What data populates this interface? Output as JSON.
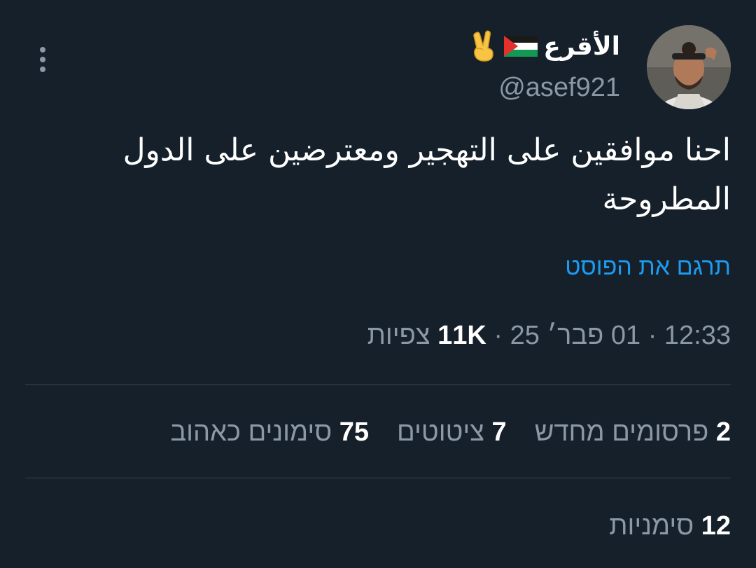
{
  "post": {
    "author_name": "الأقرع",
    "author_handle": "@asef921",
    "text": "احنا موافقين على التهجير ومعترضين على الدول المطروحة",
    "translate_label": "תרגם את הפוסט",
    "time": "12:33",
    "date": "01 פבר׳ 25",
    "separator": "·",
    "views_count": "11K",
    "views_label": "צפיות"
  },
  "stats": {
    "reposts_count": "2",
    "reposts_label": "פרסומים מחדש",
    "quotes_count": "7",
    "quotes_label": "ציטוטים",
    "likes_count": "75",
    "likes_label": "סימונים כאהוב",
    "bookmarks_count": "12",
    "bookmarks_label": "סימניות"
  },
  "icons": {
    "more": "more-vertical-icon",
    "flag": "palestine-flag-icon",
    "victory": "victory-hand-icon"
  },
  "colors": {
    "background": "#15202b",
    "text_primary": "#ffffff",
    "text_secondary": "#8b98a5",
    "link": "#1d9bf0",
    "divider": "#38444d"
  }
}
